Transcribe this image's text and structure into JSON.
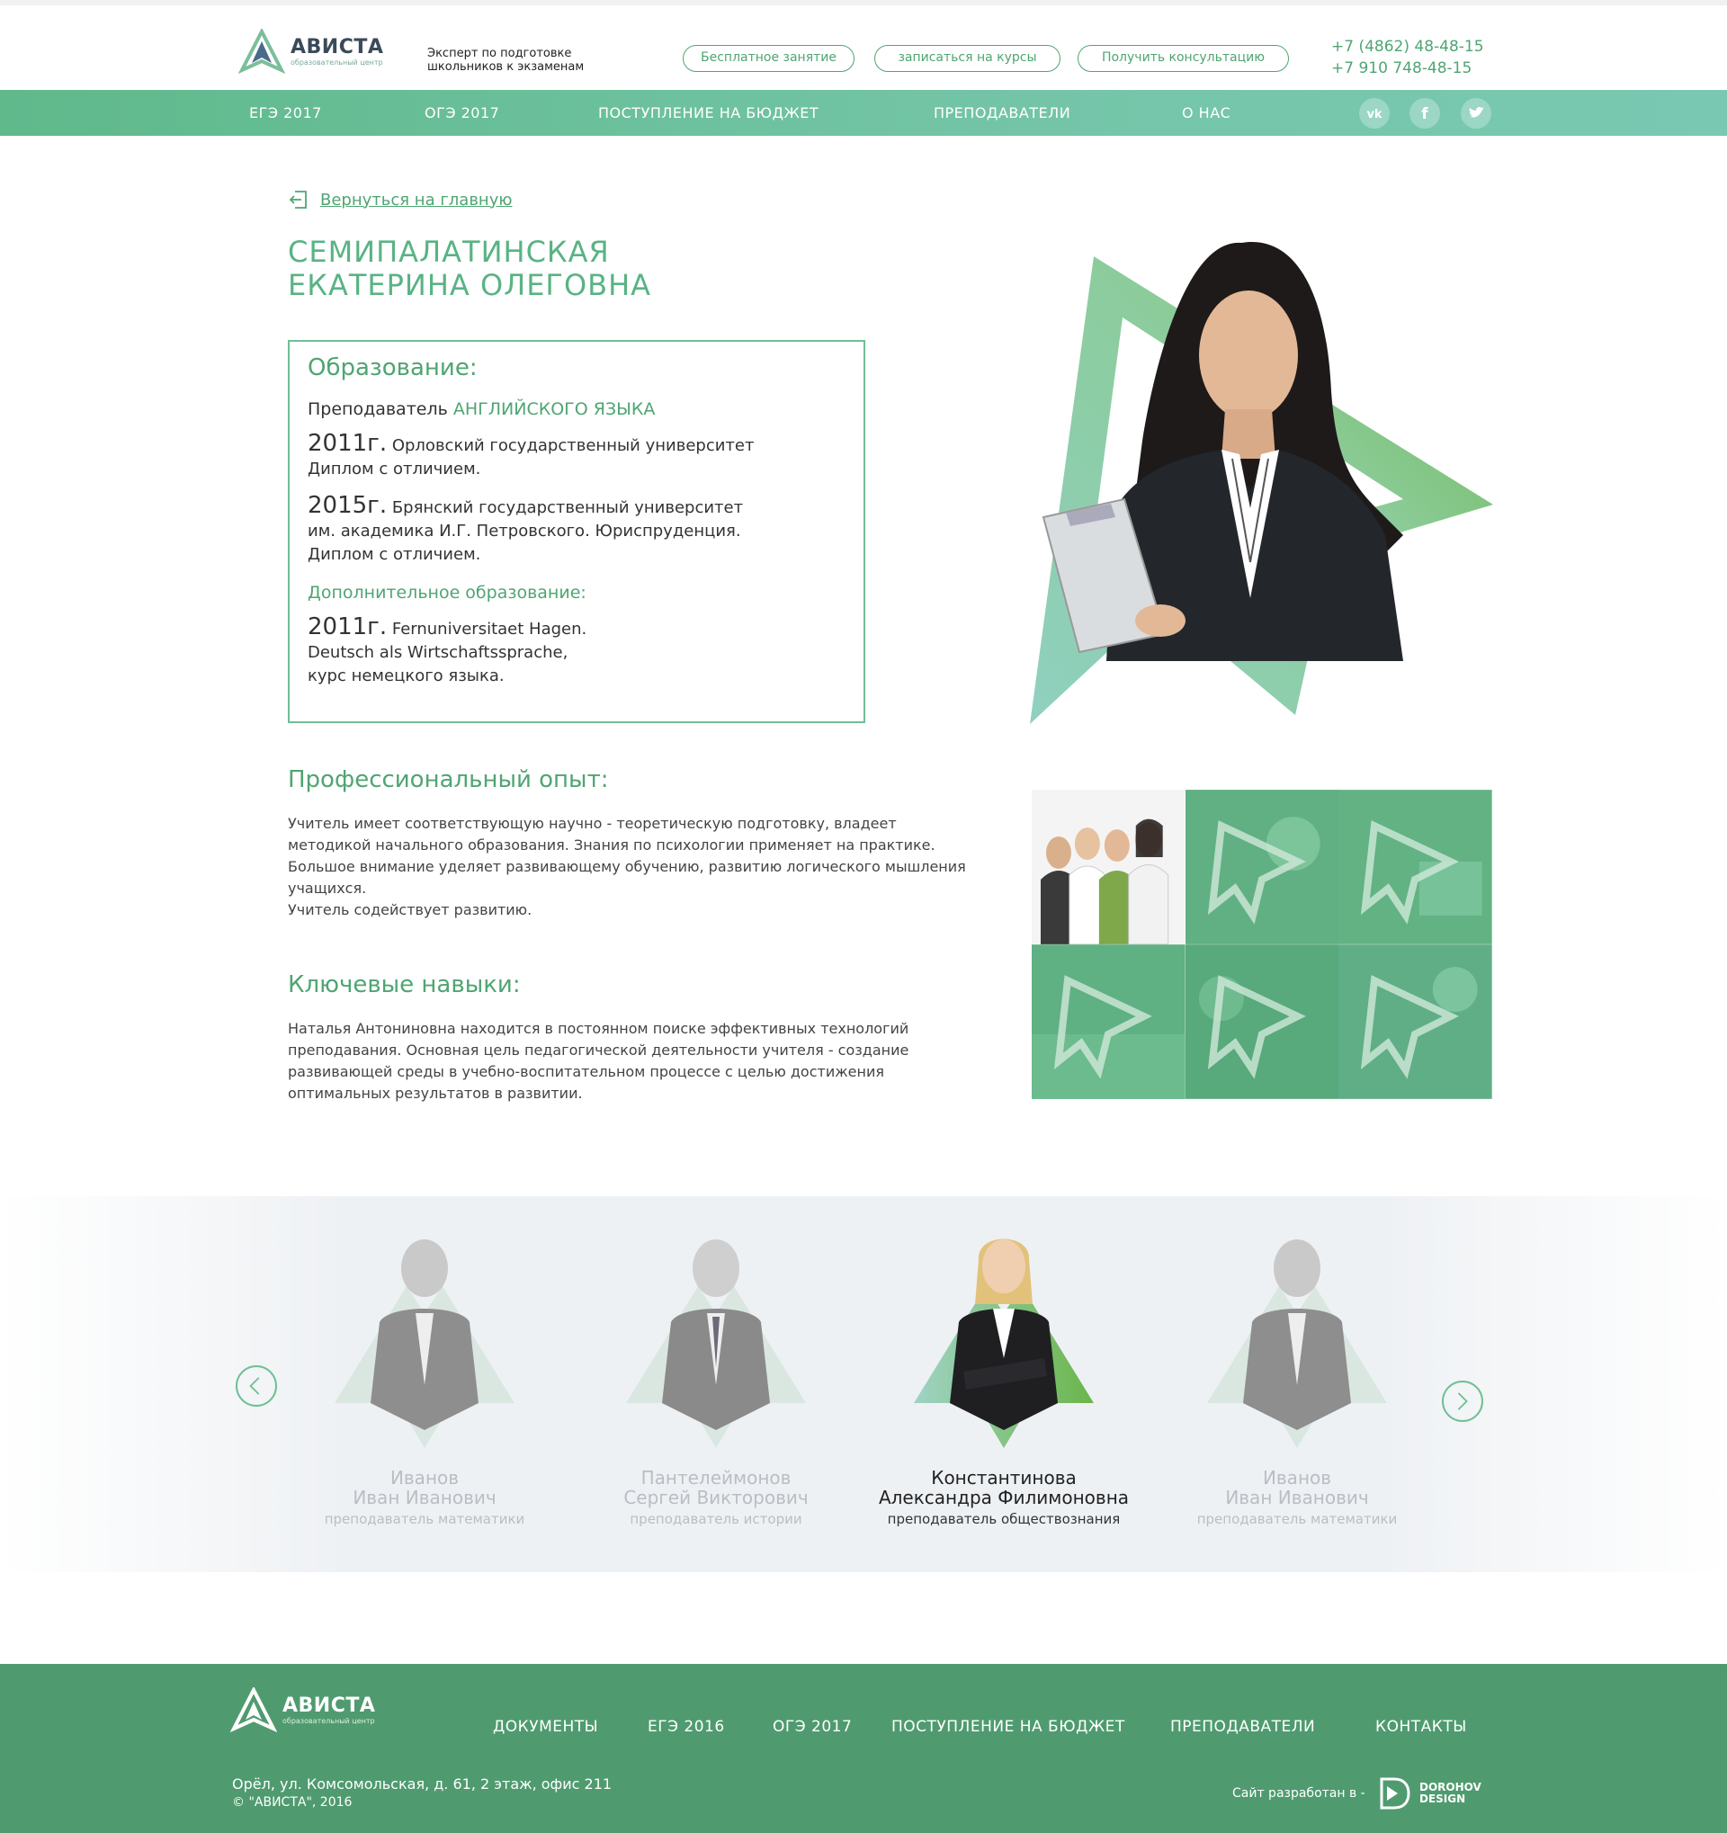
{
  "header": {
    "logo_name": "АВИСТА",
    "logo_sub": "образовательный центр",
    "tagline": "Эксперт по подготовке школьников к экзаменам",
    "buttons": [
      "Бесплатное занятие",
      "записаться на курсы",
      "Получить консультацию"
    ],
    "phones": [
      "+7 (4862) 48-48-15",
      "+7 910 748-48-15"
    ]
  },
  "nav": {
    "items": [
      "ЕГЭ 2017",
      "ОГЭ 2017",
      "ПОСТУПЛЕНИЕ НА БЮДЖЕТ",
      "ПРЕПОДАВАТЕЛИ",
      "О НАС"
    ],
    "social": [
      {
        "icon": "vk-icon",
        "glyph": "vk"
      },
      {
        "icon": "facebook-icon",
        "glyph": "f"
      },
      {
        "icon": "twitter-icon",
        "glyph": "t"
      }
    ]
  },
  "profile": {
    "back_link": "Вернуться на главную",
    "name_line1": "СЕМИПАЛАТИНСКАЯ",
    "name_line2": "ЕКАТЕРИНА ОЛЕГОВНА",
    "education": {
      "title": "Образование:",
      "teacher_prefix": "Преподаватель",
      "teacher_subject": "АНГЛИЙСКОГО ЯЗЫКА",
      "entries": [
        {
          "year": "2011г.",
          "line1": "Орловский государственный университет",
          "line2": "Диплом с отличием.",
          "line3": ""
        },
        {
          "year": "2015г.",
          "line1": "Брянский государственный университет",
          "line2": "им. академика И.Г. Петровского. Юриспруденция.",
          "line3": "Диплом с отличием."
        }
      ],
      "additional_title": "Дополнительное образование:",
      "additional": {
        "year": "2011г.",
        "line1": "Fernuniversitaet Hagen.",
        "line2": "Deutsch als Wirtschaftssprache,",
        "line3": "курс немецкого языка."
      }
    },
    "experience": {
      "title": "Профессиональный опыт:",
      "body": "Учитель имеет соответствующую научно - теоретическую подготовку, владеет методикой начального образования. Знания по психологии применяет на практике. Большое внимание уделяет развивающему обучению, развитию логического мышления учащихся.",
      "body2": "Учитель содействует развитию."
    },
    "skills": {
      "title": "Ключевые навыки:",
      "body": "Наталья Антониновна находится в постоянном поиске эффективных технологий преподавания. Основная цель педагогической деятельности учителя - создание развивающей среды в учебно-воспитательном процессе с целью достижения оптимальных результатов в развитии."
    }
  },
  "carousel": {
    "cards": [
      {
        "surname": "Иванов",
        "name": "Иван Иванович",
        "role": "преподаватель математики",
        "active": false
      },
      {
        "surname": "Пантелеймонов",
        "name": "Сергей Викторович",
        "role": "преподаватель истории",
        "active": false
      },
      {
        "surname": "Константинова",
        "name": "Александра Филимоновна",
        "role": "преподаватель обществознания",
        "active": true
      },
      {
        "surname": "Иванов",
        "name": "Иван Иванович",
        "role": "преподаватель математики",
        "active": false
      }
    ]
  },
  "footer": {
    "logo_name": "АВИСТА",
    "logo_sub": "образовательный центр",
    "nav": [
      "ДОКУМЕНТЫ",
      "ЕГЭ 2016",
      "ОГЭ 2017",
      "ПОСТУПЛЕНИЕ НА БЮДЖЕТ",
      "ПРЕПОДАВАТЕЛИ",
      "КОНТАКТЫ"
    ],
    "address": "Орёл, ул. Комсомольская, д. 61, 2 этаж, офис 211",
    "copyright": "© \"АВИСТА\", 2016",
    "developer_label": "Сайт разработан в -",
    "developer_name1": "DOROHOV",
    "developer_name2": "DESIGN"
  },
  "colors": {
    "accent": "#4fa572",
    "nav": "#6fc09c",
    "footer": "#4f9b6f"
  }
}
